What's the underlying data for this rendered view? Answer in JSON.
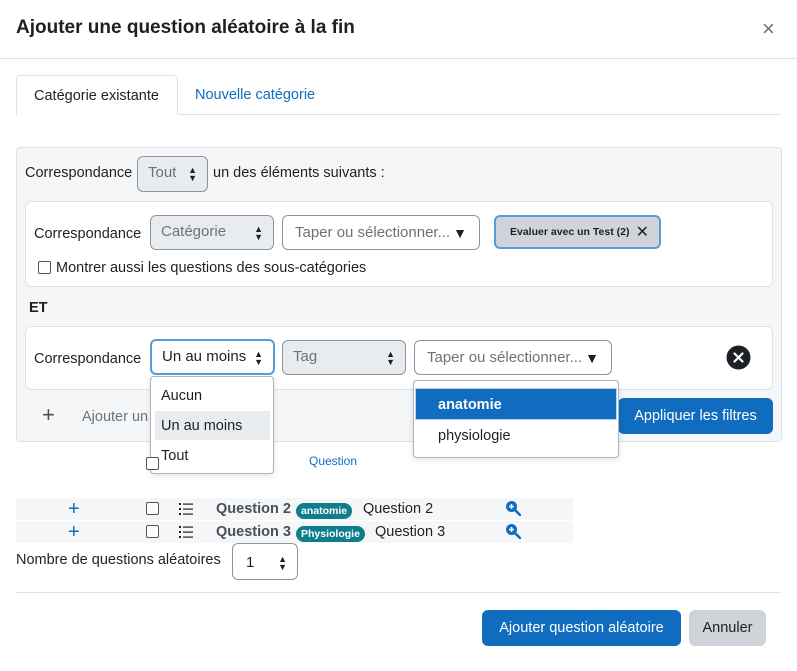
{
  "dialog": {
    "title": "Ajouter une question aléatoire à la fin",
    "close_symbol": "×"
  },
  "tabs": [
    {
      "label": "Catégorie existante",
      "active": true
    },
    {
      "label": "Nouvelle catégorie",
      "active": false
    }
  ],
  "filters": {
    "match_label": "Correspondance",
    "match_value": "Tout",
    "match_suffix": "un des éléments suivants :",
    "category_condition": {
      "label": "Correspondance",
      "type_value": "Catégorie",
      "search_placeholder": "Taper ou sélectionner...",
      "chip": "Evaluer avec un Test (2)",
      "subcategories_label": "Montrer aussi les questions des sous-catégories"
    },
    "join_label": "ET",
    "tag_condition": {
      "label": "Correspondance",
      "match_value": "Un au moins",
      "type_value": "Tag",
      "search_placeholder": "Taper ou sélectionner..."
    },
    "match_options": [
      "Aucun",
      "Un au moins",
      "Tout"
    ],
    "match_selected_index": 1,
    "tag_options": [
      "anatomie",
      "physiologie"
    ],
    "tag_selected_index": 0,
    "add_condition_label": "Ajouter un",
    "apply_button": "Appliquer les filtres"
  },
  "table": {
    "header_question": "Question",
    "rows": [
      {
        "name": "Question 2",
        "tag": "anatomie",
        "text": "Question 2"
      },
      {
        "name": "Question 3",
        "tag": "Physiologie",
        "text": "Question 3"
      }
    ]
  },
  "random_count": {
    "label": "Nombre de questions aléatoires",
    "value": "1"
  },
  "actions": {
    "add_random": "Ajouter question aléatoire",
    "cancel": "Annuler"
  },
  "colors": {
    "primary": "#0f6cbf",
    "badge": "#0f7d8c",
    "panel": "#f5f6f7",
    "selected_option": "#0f6cbf"
  }
}
